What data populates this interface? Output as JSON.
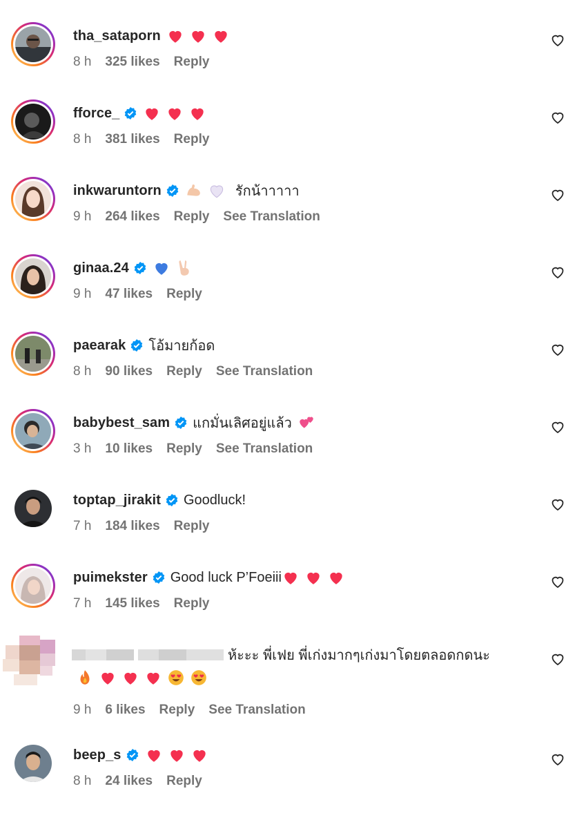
{
  "comments": [
    {
      "username": "tha_sataporn",
      "verified": false,
      "text": "",
      "emojis": [
        "red-heart",
        "red-heart",
        "red-heart"
      ],
      "time": "8 h",
      "likes": "325 likes",
      "reply": "Reply",
      "translation": ""
    },
    {
      "username": "fforce_",
      "verified": true,
      "text": "",
      "emojis": [
        "red-heart",
        "red-heart",
        "red-heart"
      ],
      "time": "8 h",
      "likes": "381 likes",
      "reply": "Reply",
      "translation": ""
    },
    {
      "username": "inkwaruntorn",
      "verified": true,
      "text": "รักน้าาาาา",
      "emojis": [
        "flexed-biceps",
        "white-heart"
      ],
      "time": "9 h",
      "likes": "264 likes",
      "reply": "Reply",
      "translation": "See Translation"
    },
    {
      "username": "ginaa.24",
      "verified": true,
      "text": "",
      "emojis": [
        "blue-heart",
        "victory-hand"
      ],
      "time": "9 h",
      "likes": "47 likes",
      "reply": "Reply",
      "translation": ""
    },
    {
      "username": "paearak",
      "verified": true,
      "text": "โอ้มายก้อด",
      "emojis": [],
      "time": "8 h",
      "likes": "90 likes",
      "reply": "Reply",
      "translation": "See Translation"
    },
    {
      "username": "babybest_sam",
      "verified": true,
      "text": "แกมั่นเลิศอยู่แล้ว",
      "emojis": [
        "two-hearts"
      ],
      "time": "3 h",
      "likes": "10 likes",
      "reply": "Reply",
      "translation": "See Translation"
    },
    {
      "username": "toptap_jirakit",
      "verified": true,
      "text": "Goodluck!",
      "emojis": [],
      "time": "7 h",
      "likes": "184 likes",
      "reply": "Reply",
      "translation": ""
    },
    {
      "username": "puimekster",
      "verified": true,
      "text": "Good luck P’Foeiii",
      "emojis": [
        "red-heart",
        "red-heart",
        "red-heart"
      ],
      "time": "7 h",
      "likes": "145 likes",
      "reply": "Reply",
      "translation": ""
    },
    {
      "username": "",
      "verified": false,
      "text": "ห้ะะะ พี่เฟย พี่เก่งมากๆเก่งมาโดยตลอดกดนะ",
      "emojis": [
        "fire",
        "red-heart",
        "red-heart",
        "red-heart",
        "heart-eyes-face",
        "heart-eyes-face"
      ],
      "time": "9 h",
      "likes": "6 likes",
      "reply": "Reply",
      "translation": "See Translation"
    },
    {
      "username": "beep_s",
      "verified": true,
      "text": "",
      "emojis": [
        "red-heart",
        "red-heart",
        "red-heart"
      ],
      "time": "8 h",
      "likes": "24 likes",
      "reply": "Reply",
      "translation": ""
    }
  ],
  "icons": {
    "like": "heart-outline-icon",
    "verified": "verified-badge-icon"
  },
  "colors": {
    "verified": "#0095f6",
    "meta": "#737373",
    "text": "#262626",
    "heart": "#f4304f"
  }
}
